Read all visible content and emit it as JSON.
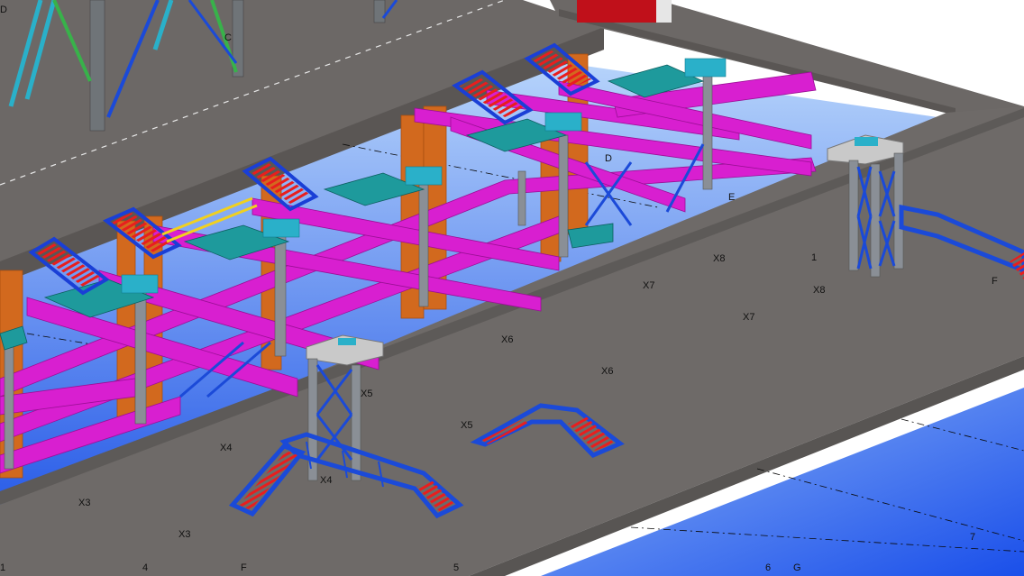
{
  "colors": {
    "slab": "#6c6866",
    "slab_edge": "#5b5856",
    "sky_top": "#9cc4f5",
    "sky_bottom": "#1f55ea",
    "column": "#d2691e",
    "beam": "#d81fd0",
    "deck": "#1e9a9c",
    "stair": "#1a3fd6",
    "tread": "#e81e1e",
    "brace_blue": "#1b4ad8",
    "brace_green": "#38b24a",
    "brace_cyan": "#2ab0c9",
    "steel_grey": "#8a8f96",
    "handrail": "#f0d020",
    "parapet_red": "#c0101a"
  },
  "grid_labels": [
    {
      "id": "C",
      "text": "C"
    },
    {
      "id": "D",
      "text": "D"
    },
    {
      "id": "E",
      "text": "E"
    },
    {
      "id": "F_right",
      "text": "F"
    },
    {
      "id": "1_right",
      "text": "1"
    },
    {
      "id": "X8a",
      "text": "X8"
    },
    {
      "id": "X8b",
      "text": "X8"
    },
    {
      "id": "X7a",
      "text": "X7"
    },
    {
      "id": "X7b",
      "text": "X7"
    },
    {
      "id": "X6a",
      "text": "X6"
    },
    {
      "id": "X6b",
      "text": "X6"
    },
    {
      "id": "X5a",
      "text": "X5"
    },
    {
      "id": "X5b",
      "text": "X5"
    },
    {
      "id": "X4a",
      "text": "X4"
    },
    {
      "id": "X4b",
      "text": "X4"
    },
    {
      "id": "X3a",
      "text": "X3"
    },
    {
      "id": "X3b",
      "text": "X3"
    },
    {
      "id": "1_bottom",
      "text": "1"
    },
    {
      "id": "4_bottom",
      "text": "4"
    },
    {
      "id": "F_bottom",
      "text": "F"
    },
    {
      "id": "5_bottom",
      "text": "5"
    },
    {
      "id": "6_bottom",
      "text": "6"
    },
    {
      "id": "G_bottom",
      "text": "G"
    },
    {
      "id": "7_right",
      "text": "7"
    },
    {
      "id": "D_topleft",
      "text": "D"
    }
  ]
}
